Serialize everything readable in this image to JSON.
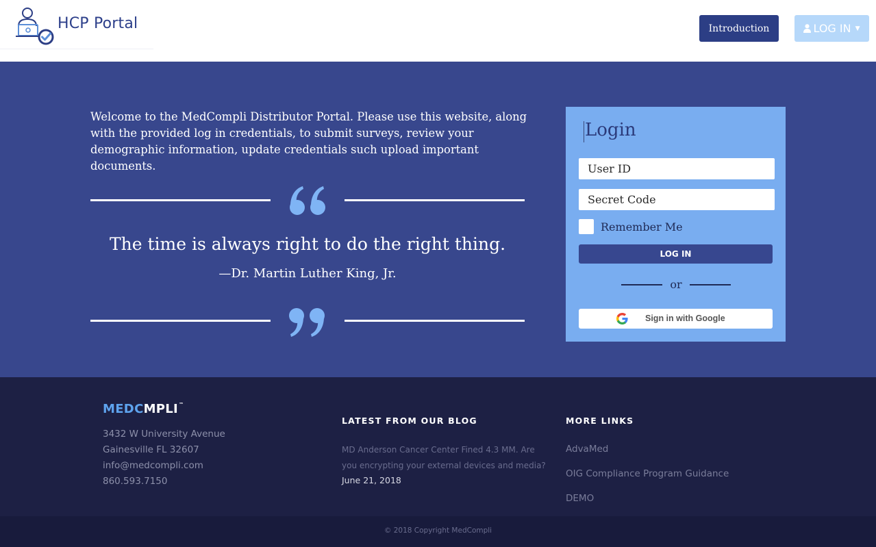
{
  "header": {
    "brand_name": "HCP Portal",
    "intro_button": "Introduction",
    "login_button": "LOG IN"
  },
  "hero": {
    "welcome_text": "Welcome to the MedCompli Distributor Portal. Please use this website, along with the provided log in credentials, to submit surveys, review your demographic information, update credentials such upload important documents.",
    "quote": "The time is always right to do the right thing.",
    "quote_author": "—Dr. Martin Luther King, Jr."
  },
  "login": {
    "title": "Login",
    "user_id_placeholder": "User ID",
    "secret_code_placeholder": "Secret Code",
    "remember_label": "Remember Me",
    "login_button": "LOG IN",
    "or_text": "or",
    "google_button": "Sign in with Google"
  },
  "footer": {
    "logo_part1": "MED",
    "logo_part2": "C",
    "logo_part3": "MPLI",
    "logo_tm": "™",
    "address_lines": [
      "3432 W University Avenue",
      "Gainesville FL 32607",
      "info@medcompli.com",
      "860.593.7150"
    ],
    "blog_heading": "LATEST FROM OUR BLOG",
    "blog_post_title": "MD Anderson Cancer Center Fined 4.3 MM. Are you encrypting your external devices and media?",
    "blog_post_date": "June 21, 2018",
    "links_heading": "MORE LINKS",
    "links": [
      "AdvaMed",
      "OIG Compliance Program Guidance",
      "DEMO"
    ],
    "copyright": "© 2018 Copyright MedCompli"
  },
  "colors": {
    "brand_navy": "#2c3e85",
    "hero_bg": "#38478d",
    "login_card_bg": "#79adf0",
    "footer_bg": "#1d2044",
    "accent_light_blue": "#b6d8fa"
  }
}
